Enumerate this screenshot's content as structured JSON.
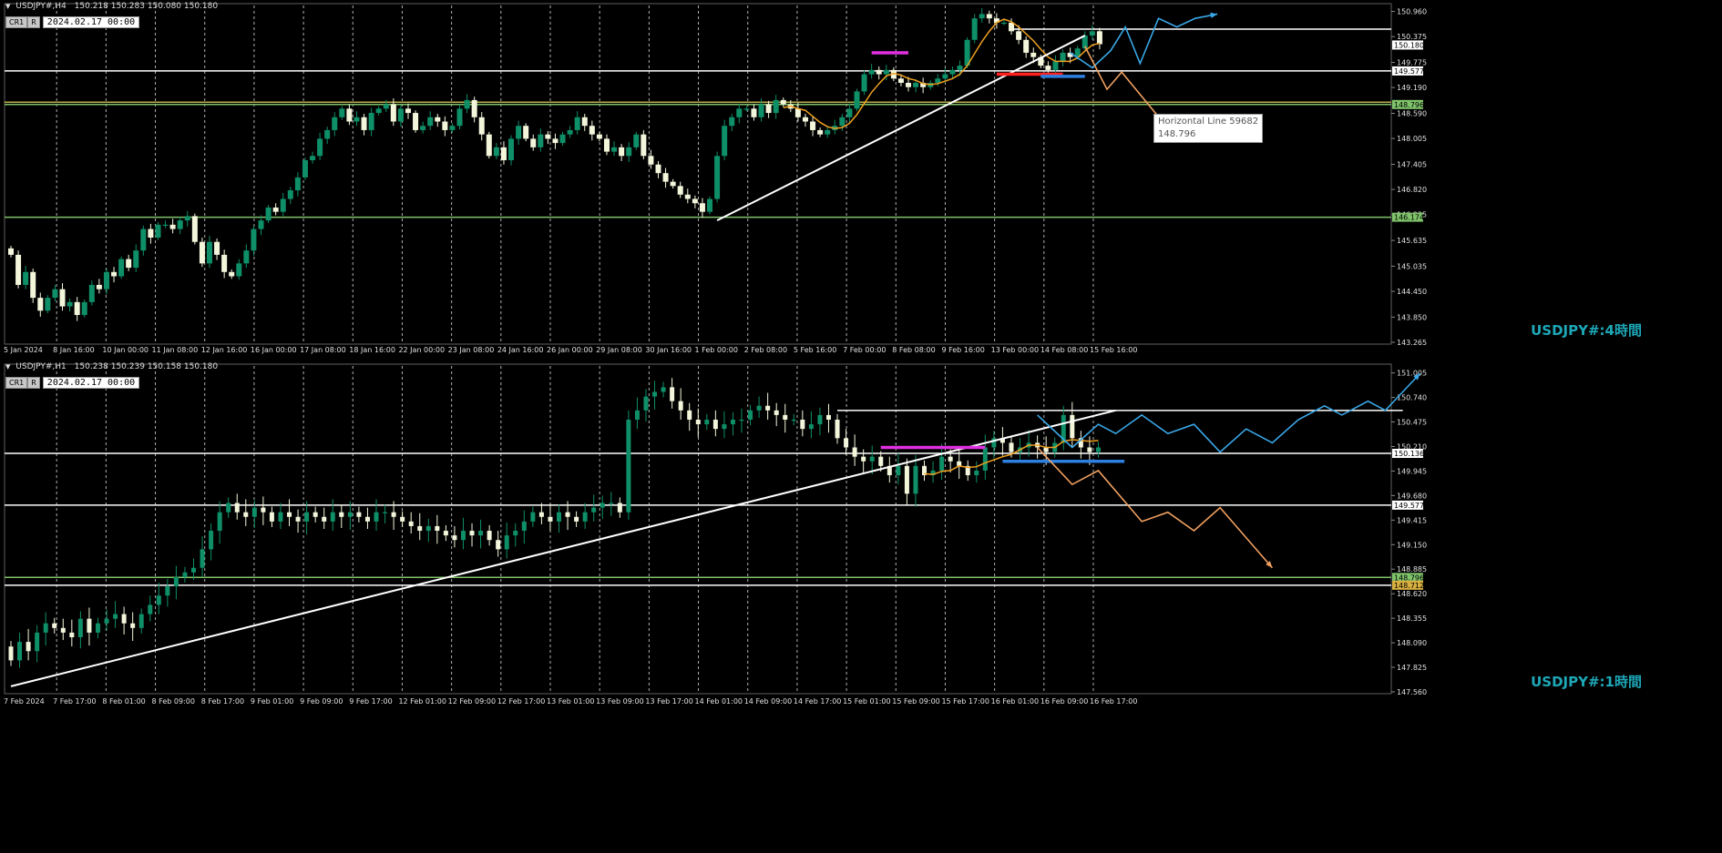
{
  "colors": {
    "background": "#000000",
    "bull": "#0e8f68",
    "bear": "#f4f6dc",
    "grid": "#cfcfcf",
    "axis_text": "#e0e0e0",
    "watermark": "#1ea8b8",
    "white_line": "#ffffff",
    "green_line": "#7fc36a",
    "olive_line": "#b9b04a",
    "ma": "#f0a020",
    "orange": "#f0a060",
    "blue": "#3aa8e8",
    "magenta": "#e030e0",
    "red": "#ff2020",
    "hblue": "#2d7fe0"
  },
  "chart_data": [
    {
      "type": "candlestick",
      "symbol": "USDJPY#,H4",
      "ohlc": "150.218 150.283 150.080 150.180",
      "date_box": "2024.02.17 00:00",
      "buttons": [
        "CR1",
        "R"
      ],
      "watermark": "USDJPY#:4時間",
      "ylim": [
        143.265,
        151.1
      ],
      "y_ticks": [
        "150.960",
        "150.375",
        "149.775",
        "149.190",
        "148.590",
        "148.005",
        "147.405",
        "146.820",
        "146.235",
        "145.635",
        "145.035",
        "144.450",
        "143.850",
        "143.265"
      ],
      "x_ticks": [
        "5 Jan 2024",
        "8 Jan 16:00",
        "10 Jan 00:00",
        "11 Jan 08:00",
        "12 Jan 16:00",
        "16 Jan 00:00",
        "17 Jan 08:00",
        "18 Jan 16:00",
        "22 Jan 00:00",
        "23 Jan 08:00",
        "24 Jan 16:00",
        "26 Jan 00:00",
        "29 Jan 08:00",
        "30 Jan 16:00",
        "1 Feb 00:00",
        "2 Feb 08:00",
        "5 Feb 16:00",
        "7 Feb 00:00",
        "8 Feb 08:00",
        "9 Feb 16:00",
        "13 Feb 00:00",
        "14 Feb 08:00",
        "15 Feb 16:00"
      ],
      "price_labels": [
        {
          "text": "150.180",
          "value": 150.18,
          "bg": "#ffffff",
          "fg": "#000000"
        },
        {
          "text": "149.577",
          "value": 149.577,
          "bg": "#ffffff",
          "fg": "#000000"
        },
        {
          "text": "148.796",
          "value": 148.796,
          "bg": "#7fc36a",
          "fg": "#000000"
        },
        {
          "text": "146.174",
          "value": 146.174,
          "bg": "#7fc36a",
          "fg": "#000000"
        }
      ],
      "tooltip": [
        "Horizontal Line 59682",
        "148.796"
      ],
      "close": [
        145.3,
        144.6,
        144.9,
        144.3,
        144.0,
        144.3,
        144.5,
        144.1,
        144.2,
        143.9,
        144.2,
        144.6,
        144.5,
        144.9,
        144.8,
        145.2,
        145.0,
        145.4,
        145.9,
        145.7,
        146.0,
        146.0,
        145.9,
        146.1,
        146.2,
        145.6,
        145.1,
        145.6,
        145.3,
        144.9,
        144.8,
        145.1,
        145.4,
        145.9,
        146.1,
        146.4,
        146.3,
        146.6,
        146.8,
        147.1,
        147.5,
        147.6,
        148.0,
        148.2,
        148.5,
        148.7,
        148.4,
        148.5,
        148.2,
        148.6,
        148.7,
        148.8,
        148.4,
        148.7,
        148.6,
        148.2,
        148.3,
        148.5,
        148.4,
        148.2,
        148.3,
        148.7,
        148.9,
        148.5,
        148.1,
        147.6,
        147.8,
        147.5,
        148.0,
        148.3,
        148.0,
        147.8,
        148.1,
        148.0,
        147.9,
        148.1,
        148.2,
        148.5,
        148.3,
        148.1,
        148.0,
        147.7,
        147.8,
        147.6,
        147.8,
        148.1,
        147.6,
        147.4,
        147.2,
        147.0,
        146.9,
        146.7,
        146.6,
        146.5,
        146.3,
        146.6,
        147.6,
        148.3,
        148.5,
        148.7,
        148.7,
        148.5,
        148.8,
        148.6,
        148.9,
        148.8,
        148.7,
        148.5,
        148.4,
        148.2,
        148.1,
        148.2,
        148.3,
        148.5,
        148.7,
        149.1,
        149.5,
        149.6,
        149.5,
        149.6,
        149.4,
        149.3,
        149.2,
        149.3,
        149.2,
        149.3,
        149.4,
        149.5,
        149.6,
        149.7,
        150.3,
        150.8,
        150.9,
        150.8,
        150.7,
        150.7,
        150.5,
        150.3,
        150.0,
        149.9,
        149.7,
        149.6,
        149.8,
        150.0,
        149.9,
        150.1,
        150.4,
        150.5,
        150.2
      ],
      "trendline": [
        [
          96,
          146.1
        ],
        [
          146,
          150.4
        ]
      ],
      "rays": [
        {
          "color": "blue",
          "points": [
            [
              144,
              150.0
            ],
            [
              147,
              149.65
            ],
            [
              149.5,
              150.05
            ],
            [
              151.5,
              150.6
            ],
            [
              153.5,
              149.75
            ],
            [
              156,
              150.8
            ],
            [
              158.5,
              150.6
            ],
            [
              161,
              150.8
            ],
            [
              164,
              150.9
            ]
          ],
          "arrow": true
        },
        {
          "color": "orange",
          "points": [
            [
              146,
              150.15
            ],
            [
              149,
              149.15
            ],
            [
              151,
              149.55
            ],
            [
              157.5,
              148.2
            ]
          ],
          "arrow": true
        }
      ],
      "hlines": [
        {
          "value": 150.55,
          "color": "white",
          "from": 136,
          "to": 170
        },
        {
          "value": 149.577,
          "color": "white",
          "from": 0,
          "to": 190
        },
        {
          "value": 148.85,
          "color": "olive",
          "from": 0,
          "to": 190
        },
        {
          "value": 148.796,
          "color": "green",
          "from": 0,
          "to": 190
        },
        {
          "value": 146.174,
          "color": "green",
          "from": 0,
          "to": 190
        }
      ],
      "segments": [
        {
          "color": "magenta",
          "value": 150.0,
          "from": 117,
          "to": 122
        },
        {
          "color": "red",
          "value": 149.5,
          "from": 134,
          "to": 143
        },
        {
          "color": "hblue",
          "value": 149.45,
          "from": 140,
          "to": 146
        }
      ]
    },
    {
      "type": "candlestick",
      "symbol": "USDJPY#,H1",
      "ohlc": "150.238 150.239 150.158 150.180",
      "date_box": "2024.02.17 00:00",
      "buttons": [
        "CR1",
        "R"
      ],
      "watermark": "USDJPY#:1時間",
      "ylim": [
        147.56,
        151.08
      ],
      "y_ticks": [
        "151.005",
        "150.740",
        "150.475",
        "150.210",
        "149.945",
        "149.680",
        "149.415",
        "149.150",
        "148.885",
        "148.620",
        "148.355",
        "148.090",
        "147.825",
        "147.560"
      ],
      "x_ticks": [
        "7 Feb 2024",
        "7 Feb 17:00",
        "8 Feb 01:00",
        "8 Feb 09:00",
        "8 Feb 17:00",
        "9 Feb 01:00",
        "9 Feb 09:00",
        "9 Feb 17:00",
        "12 Feb 01:00",
        "12 Feb 09:00",
        "12 Feb 17:00",
        "13 Feb 01:00",
        "13 Feb 09:00",
        "13 Feb 17:00",
        "14 Feb 01:00",
        "14 Feb 09:00",
        "14 Feb 17:00",
        "15 Feb 01:00",
        "15 Feb 09:00",
        "15 Feb 17:00",
        "16 Feb 01:00",
        "16 Feb 09:00",
        "16 Feb 17:00"
      ],
      "price_labels": [
        {
          "text": "150.136",
          "value": 150.136,
          "bg": "#ffffff",
          "fg": "#000000"
        },
        {
          "text": "149.577",
          "value": 149.577,
          "bg": "#ffffff",
          "fg": "#000000"
        },
        {
          "text": "148.796",
          "value": 148.796,
          "bg": "#7fc36a",
          "fg": "#000000"
        },
        {
          "text": "148.712",
          "value": 148.712,
          "bg": "#d8b040",
          "fg": "#000000"
        }
      ],
      "close": [
        147.9,
        148.1,
        148.0,
        148.2,
        148.3,
        148.25,
        148.2,
        148.15,
        148.35,
        148.2,
        148.3,
        148.35,
        148.4,
        148.3,
        148.25,
        148.4,
        148.5,
        148.6,
        148.7,
        148.8,
        148.85,
        148.9,
        149.1,
        149.3,
        149.5,
        149.6,
        149.5,
        149.45,
        149.55,
        149.5,
        149.4,
        149.5,
        149.45,
        149.4,
        149.5,
        149.45,
        149.4,
        149.5,
        149.45,
        149.5,
        149.45,
        149.4,
        149.5,
        149.5,
        149.45,
        149.4,
        149.35,
        149.3,
        149.35,
        149.3,
        149.25,
        149.2,
        149.3,
        149.25,
        149.3,
        149.2,
        149.1,
        149.25,
        149.3,
        149.4,
        149.5,
        149.45,
        149.4,
        149.5,
        149.45,
        149.4,
        149.5,
        149.55,
        149.6,
        149.6,
        149.5,
        150.5,
        150.6,
        150.75,
        150.8,
        150.85,
        150.7,
        150.6,
        150.5,
        150.45,
        150.5,
        150.4,
        150.45,
        150.5,
        150.5,
        150.6,
        150.65,
        150.6,
        150.55,
        150.5,
        150.5,
        150.4,
        150.45,
        150.55,
        150.5,
        150.3,
        150.2,
        150.1,
        150.05,
        150.1,
        150.0,
        149.9,
        150.0,
        149.7,
        150.0,
        149.9,
        149.95,
        150.1,
        150.05,
        150.0,
        149.9,
        149.95,
        150.2,
        150.3,
        150.25,
        150.15,
        150.2,
        150.25,
        150.2,
        150.15,
        150.25,
        150.55,
        150.3,
        150.2,
        150.15,
        150.2
      ],
      "trendline": [
        [
          0,
          147.62
        ],
        [
          127,
          150.6
        ]
      ],
      "rays": [
        {
          "color": "blue",
          "points": [
            [
              118,
              150.55
            ],
            [
              122,
              150.2
            ],
            [
              125,
              150.45
            ],
            [
              127,
              150.35
            ],
            [
              130,
              150.55
            ],
            [
              133,
              150.35
            ],
            [
              136,
              150.45
            ],
            [
              139,
              150.15
            ],
            [
              142,
              150.4
            ],
            [
              145,
              150.25
            ],
            [
              148,
              150.5
            ],
            [
              151,
              150.65
            ],
            [
              153,
              150.55
            ],
            [
              156,
              150.7
            ],
            [
              158,
              150.6
            ],
            [
              162,
              151.0
            ]
          ],
          "arrow": true
        },
        {
          "color": "orange",
          "points": [
            [
              118,
              150.2
            ],
            [
              122,
              149.8
            ],
            [
              125,
              149.95
            ],
            [
              130,
              149.4
            ],
            [
              133,
              149.5
            ],
            [
              136,
              149.3
            ],
            [
              139,
              149.55
            ],
            [
              145,
              148.9
            ]
          ],
          "arrow": true
        }
      ],
      "hlines": [
        {
          "value": 150.6,
          "color": "white",
          "from": 95,
          "to": 160
        },
        {
          "value": 150.136,
          "color": "white",
          "from": 0,
          "to": 170
        },
        {
          "value": 149.577,
          "color": "white",
          "from": 0,
          "to": 170
        },
        {
          "value": 148.796,
          "color": "green",
          "from": 0,
          "to": 170
        },
        {
          "value": 148.712,
          "color": "white",
          "from": 0,
          "to": 170
        }
      ],
      "segments": [
        {
          "color": "magenta",
          "value": 150.2,
          "from": 100,
          "to": 112
        },
        {
          "color": "hblue",
          "value": 150.05,
          "from": 114,
          "to": 128
        }
      ]
    }
  ]
}
